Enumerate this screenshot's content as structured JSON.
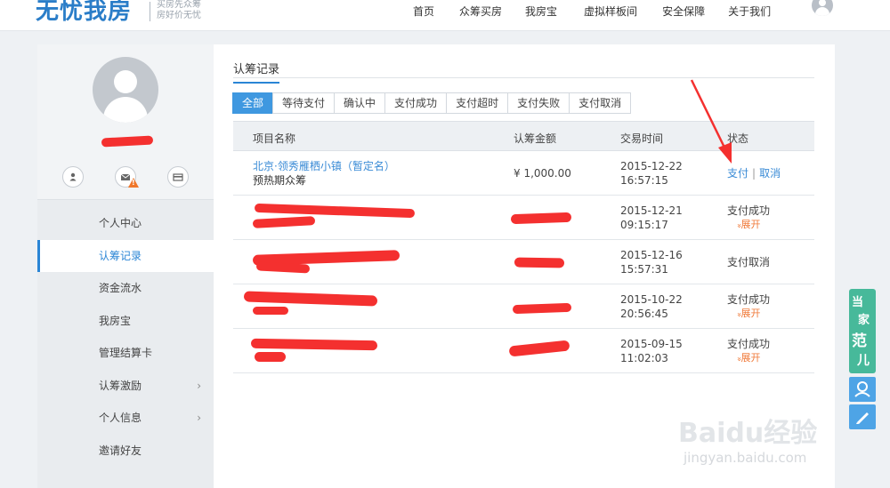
{
  "header": {
    "logo": "无忧我房",
    "slogan_line1": "买房先众筹",
    "slogan_line2": "房好价无忧",
    "nav": [
      "首页",
      "众筹买房",
      "我房宝",
      "虚拟样板间",
      "安全保障",
      "关于我们"
    ]
  },
  "sidebar": {
    "items": [
      {
        "label": "个人中心",
        "active": false,
        "has_chevron": false
      },
      {
        "label": "认筹记录",
        "active": true,
        "has_chevron": false
      },
      {
        "label": "资金流水",
        "active": false,
        "has_chevron": false
      },
      {
        "label": "我房宝",
        "active": false,
        "has_chevron": false
      },
      {
        "label": "管理结算卡",
        "active": false,
        "has_chevron": false
      },
      {
        "label": "认筹激励",
        "active": false,
        "has_chevron": true
      },
      {
        "label": "个人信息",
        "active": false,
        "has_chevron": true
      },
      {
        "label": "邀请好友",
        "active": false,
        "has_chevron": false
      }
    ],
    "chevron": "›"
  },
  "main": {
    "title": "认筹记录",
    "tabs": [
      "全部",
      "等待支付",
      "确认中",
      "支付成功",
      "支付超时",
      "支付失败",
      "支付取消"
    ],
    "columns": [
      "项目名称",
      "认筹金额",
      "交易时间",
      "状态"
    ],
    "rows": [
      {
        "name": "北京·领秀雁栖小镇（暂定名）",
        "sub": "预热期众筹",
        "amount": "¥ 1,000.00",
        "date": "2015-12-22",
        "time": "16:57:15",
        "pay": "支付",
        "sep": "|",
        "cancel": "取消"
      },
      {
        "date": "2015-12-21",
        "time": "09:15:17",
        "status": "支付成功",
        "expand": "展开"
      },
      {
        "date": "2015-12-16",
        "time": "15:57:31",
        "status": "支付取消"
      },
      {
        "date": "2015-10-22",
        "time": "20:56:45",
        "status": "支付成功",
        "expand": "展开"
      },
      {
        "date": "2015-09-15",
        "time": "11:02:03",
        "status": "支付成功",
        "expand": "展开"
      }
    ]
  },
  "float": {
    "chars": [
      "当",
      "家",
      "范",
      "儿"
    ]
  },
  "watermark": {
    "main": "Baidu经验",
    "sub": "jingyan.baidu.com"
  },
  "colors": {
    "accent": "#2a85d5",
    "tab_active": "#3f98e0",
    "warn": "#f07a3a",
    "annotation": "#f4302f"
  }
}
